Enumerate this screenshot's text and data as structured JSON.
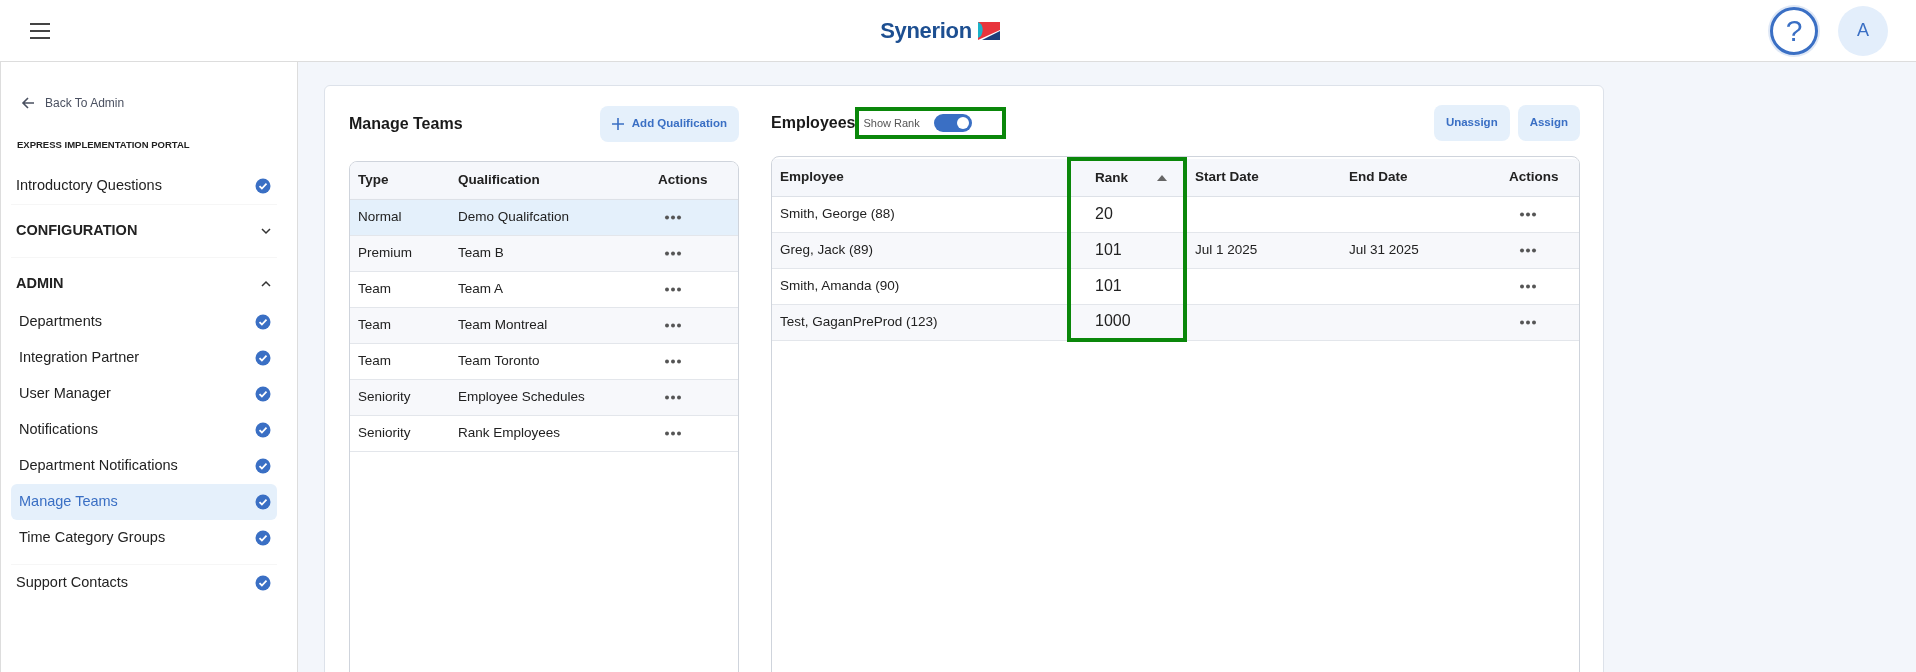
{
  "header": {
    "logo": "Synerion",
    "help": "?",
    "avatar": "A"
  },
  "sidebar": {
    "back_link": "Back To Admin",
    "portal_title": "EXPRESS IMPLEMENTATION PORTAL",
    "items": [
      {
        "kind": "item",
        "label": "Introductory Questions",
        "completed": true,
        "selected": false
      },
      {
        "kind": "section",
        "label": "CONFIGURATION",
        "expanded": false
      },
      {
        "kind": "section",
        "label": "ADMIN",
        "expanded": true,
        "children": [
          {
            "label": "Departments",
            "completed": true,
            "selected": false
          },
          {
            "label": "Integration Partner",
            "completed": true,
            "selected": false
          },
          {
            "label": "User Manager",
            "completed": true,
            "selected": false
          },
          {
            "label": "Notifications",
            "completed": true,
            "selected": false
          },
          {
            "label": "Department Notifications",
            "completed": true,
            "selected": false
          },
          {
            "label": "Manage Teams",
            "completed": true,
            "selected": true
          },
          {
            "label": "Time Category Groups",
            "completed": true,
            "selected": false
          }
        ]
      },
      {
        "kind": "item",
        "label": "Support Contacts",
        "completed": true,
        "selected": false
      }
    ]
  },
  "teams": {
    "title": "Manage Teams",
    "add_button": "Add Qualification",
    "columns": [
      "Type",
      "Qualification",
      "Actions"
    ],
    "rows": [
      {
        "type": "Normal",
        "qualification": "Demo Qualifcation",
        "selected": true
      },
      {
        "type": "Premium",
        "qualification": "Team B",
        "selected": false
      },
      {
        "type": "Team",
        "qualification": "Team A",
        "selected": false
      },
      {
        "type": "Team",
        "qualification": "Team Montreal",
        "selected": false
      },
      {
        "type": "Team",
        "qualification": "Team Toronto",
        "selected": false
      },
      {
        "type": "Seniority",
        "qualification": "Employee Schedules",
        "selected": false
      },
      {
        "type": "Seniority",
        "qualification": "Rank Employees",
        "selected": false
      }
    ]
  },
  "employees": {
    "title": "Employees",
    "toggle": {
      "label": "Show Rank",
      "on": true,
      "highlighted": true
    },
    "buttons": [
      "Unassign",
      "Assign"
    ],
    "columns": [
      {
        "label": "Employee"
      },
      {
        "label": "Rank",
        "sorted_ascending": true,
        "highlighted": true
      },
      {
        "label": "Start Date"
      },
      {
        "label": "End Date"
      },
      {
        "label": "Actions"
      }
    ],
    "rows": [
      {
        "employee": "Smith, George (88)",
        "rank": "20"
      },
      {
        "employee": "Greg, Jack (89)",
        "rank": "101",
        "start_date": "Jul 1 2025",
        "end_date": "Jul 31 2025"
      },
      {
        "employee": "Smith, Amanda (90)",
        "rank": "101"
      },
      {
        "employee": "Test, GaganPreProd (123)",
        "rank": "1000"
      }
    ]
  }
}
